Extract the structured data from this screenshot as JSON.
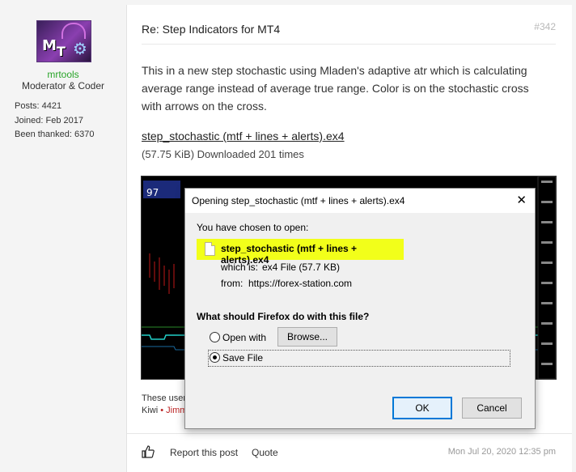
{
  "user": {
    "name": "mrtools",
    "role": "Moderator & Coder",
    "posts": "Posts: 4421",
    "joined": "Joined: Feb 2017",
    "thanked": "Been thanked: 6370"
  },
  "post": {
    "title": "Re: Step Indicators for MT4",
    "number": "#342",
    "body": "This in a new step stochastic using Mladen's adaptive atr which is calculating average range instead of average true range. Color is on the stochastic cross with arrows on the cross.",
    "attachment": {
      "name": "step_stochastic (mtf + lines + alerts).ex4",
      "meta": "(57.75 KiB) Downloaded 201 times"
    },
    "chart_label": "97",
    "thanks_line1": "These user",
    "thanks_prefix": "Kiwi",
    "thanks_sep": "•",
    "thanks_name": "Jimm",
    "footer": {
      "report": "Report this post",
      "quote": "Quote",
      "date": "Mon Jul 20, 2020 12:35 pm"
    }
  },
  "dialog": {
    "title": "Opening step_stochastic (mtf + lines + alerts).ex4",
    "close": "✕",
    "chosen": "You have chosen to open:",
    "filename": "step_stochastic (mtf + lines + alerts).ex4",
    "which_is_label": "which is:",
    "which_is_value": "ex4 File (57.7 KB)",
    "from_label": "from:",
    "from_value": "https://forex-station.com",
    "question": "What should Firefox do with this file?",
    "open_with": "Open with",
    "browse": "Browse...",
    "save_file": "Save File",
    "ok": "OK",
    "cancel": "Cancel"
  },
  "colors": {
    "username": "#28a428",
    "highlight": "#f2ff1a",
    "ok_border": "#0078d7"
  }
}
